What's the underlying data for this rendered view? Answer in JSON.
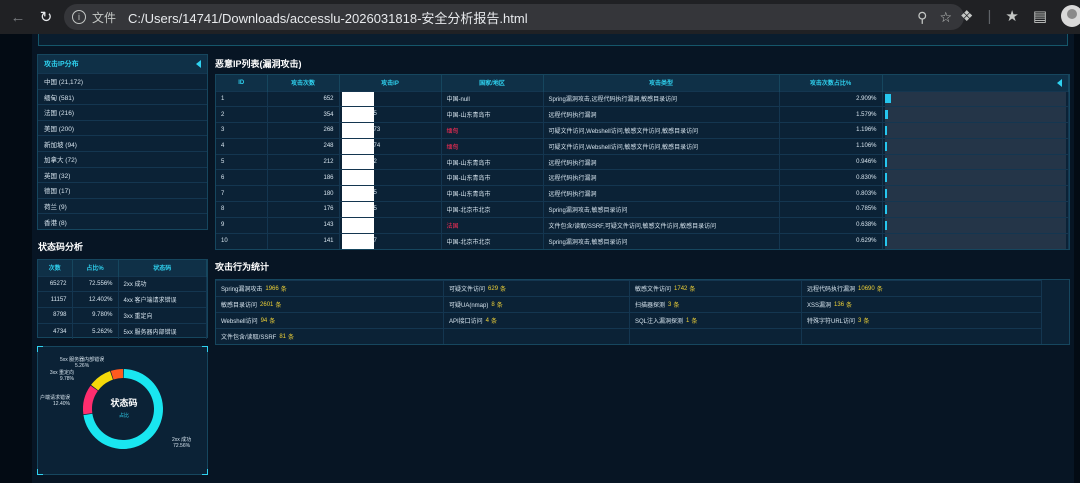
{
  "browser": {
    "scheme_label": "文件",
    "url": "C:/Users/14741/Downloads/accesslu-2026031818-安全分析报告.html"
  },
  "geo_panel": {
    "title": "攻击IP分布",
    "items": [
      {
        "label": "中国 (21,172)"
      },
      {
        "label": "缅甸 (581)"
      },
      {
        "label": "法国 (216)"
      },
      {
        "label": "美国 (200)"
      },
      {
        "label": "新加坡 (94)"
      },
      {
        "label": "加拿大 (72)"
      },
      {
        "label": "英国 (32)"
      },
      {
        "label": "德国 (17)"
      },
      {
        "label": "荷兰 (9)"
      },
      {
        "label": "香港 (8)"
      }
    ]
  },
  "status_section": {
    "title": "状态码分析",
    "headers": [
      "次数",
      "占比%",
      "状态码"
    ],
    "rows": [
      {
        "count": "65272",
        "pct": "72.556%",
        "code": "2xx 成功"
      },
      {
        "count": "11157",
        "pct": "12.402%",
        "code": "4xx 客户端请求错误"
      },
      {
        "count": "8798",
        "pct": "9.780%",
        "code": "3xx 重定向"
      },
      {
        "count": "4734",
        "pct": "5.262%",
        "code": "5xx 服务器内部错误"
      }
    ]
  },
  "donut": {
    "center_title": "状态码",
    "center_sub": "占比",
    "segments": [
      {
        "name": "2xx 成功",
        "pct": "72.56%",
        "value": 72.556,
        "color": "#19e6f0"
      },
      {
        "name": "户端请求错误",
        "pct": "12.40%",
        "value": 12.402,
        "color": "#ff2d6e"
      },
      {
        "name": "3xx 重定向",
        "pct": "9.78%",
        "value": 9.78,
        "color": "#f5d90a"
      },
      {
        "name": "5xx 服务器内部错误",
        "pct": "5.26%",
        "value": 5.262,
        "color": "#ff5a1f"
      }
    ]
  },
  "malicious": {
    "title": "恶意IP列表(漏洞攻击)",
    "headers": [
      "ID",
      "攻击次数",
      "攻击IP",
      "国家/地区",
      "攻击类型",
      "攻击次数占比%"
    ],
    "rows": [
      {
        "id": "1",
        "count": "652",
        "ip_tail": "",
        "region": "中国-null",
        "red": false,
        "type": "Spring漏洞攻击,远程代码执行漏洞,敏感目录访问",
        "pct": "2.909%",
        "bar": 2.909
      },
      {
        "id": "2",
        "count": "354",
        "ip_tail": "5",
        "region": "中国-山东青岛市",
        "red": false,
        "type": "远程代码执行漏洞",
        "pct": "1.579%",
        "bar": 1.579
      },
      {
        "id": "3",
        "count": "268",
        "ip_tail": "73",
        "region": "缅甸",
        "red": true,
        "type": "可疑文件访问,Webshell访问,敏感文件访问,敏感目录访问",
        "pct": "1.196%",
        "bar": 1.196
      },
      {
        "id": "4",
        "count": "248",
        "ip_tail": "74",
        "region": "缅甸",
        "red": true,
        "type": "可疑文件访问,Webshell访问,敏感文件访问,敏感目录访问",
        "pct": "1.106%",
        "bar": 1.106
      },
      {
        "id": "5",
        "count": "212",
        "ip_tail": "2",
        "region": "中国-山东青岛市",
        "red": false,
        "type": "远程代码执行漏洞",
        "pct": "0.946%",
        "bar": 0.946
      },
      {
        "id": "6",
        "count": "186",
        "ip_tail": "",
        "region": "中国-山东青岛市",
        "red": false,
        "type": "远程代码执行漏洞",
        "pct": "0.830%",
        "bar": 0.83
      },
      {
        "id": "7",
        "count": "180",
        "ip_tail": "5",
        "region": "中国-山东青岛市",
        "red": false,
        "type": "远程代码执行漏洞",
        "pct": "0.803%",
        "bar": 0.803
      },
      {
        "id": "8",
        "count": "176",
        "ip_tail": "5",
        "region": "中国-北京市北京",
        "red": false,
        "type": "Spring漏洞攻击,敏感目录访问",
        "pct": "0.785%",
        "bar": 0.785
      },
      {
        "id": "9",
        "count": "143",
        "ip_tail": "",
        "region": "法国",
        "red": true,
        "type": "文件包含/读取/SSRF,可疑文件访问,敏感文件访问,敏感目录访问",
        "pct": "0.638%",
        "bar": 0.638
      },
      {
        "id": "10",
        "count": "141",
        "ip_tail": "7",
        "region": "中国-北京市北京",
        "red": false,
        "type": "Spring漏洞攻击,敏感目录访问",
        "pct": "0.629%",
        "bar": 0.629
      }
    ]
  },
  "attack_stats": {
    "title": "攻击行为统计",
    "unit": "条",
    "cells": [
      {
        "label": "Spring漏洞攻击",
        "num": "1966"
      },
      {
        "label": "可疑文件访问",
        "num": "629"
      },
      {
        "label": "敏感文件访问",
        "num": "1742"
      },
      {
        "label": "远程代码执行漏洞",
        "num": "10690"
      },
      {
        "label": "敏感目录访问",
        "num": "2601"
      },
      {
        "label": "可疑UA(nmap)",
        "num": "8"
      },
      {
        "label": "扫描器探测",
        "num": "3"
      },
      {
        "label": "XSS漏洞",
        "num": "136"
      },
      {
        "label": "Webshell访问",
        "num": "94"
      },
      {
        "label": "API接口访问",
        "num": "4"
      },
      {
        "label": "SQL注入漏洞探测",
        "num": "1"
      },
      {
        "label": "特殊字符URL访问",
        "num": "3"
      },
      {
        "label": "文件包含/读取/SSRF",
        "num": "81"
      },
      {
        "label": "",
        "num": ""
      },
      {
        "label": "",
        "num": ""
      },
      {
        "label": "",
        "num": ""
      }
    ]
  }
}
